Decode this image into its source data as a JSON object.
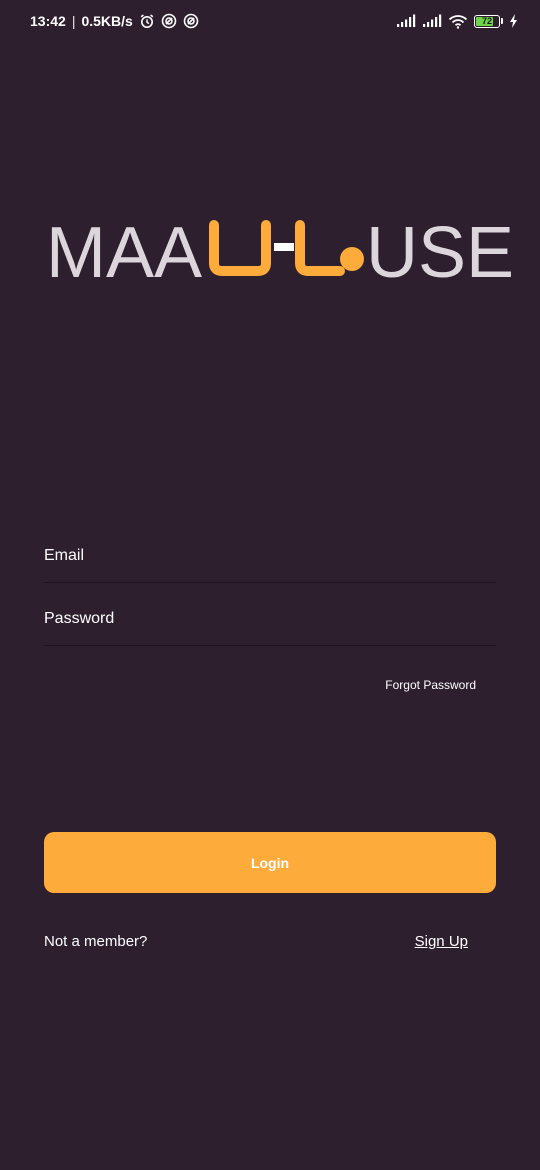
{
  "status_bar": {
    "time": "13:42",
    "separator": "|",
    "network_speed": "0.5KB/s",
    "battery_level": "72",
    "icons": [
      "alarm-icon",
      "sync-icon",
      "sync-icon",
      "signal-icon",
      "signal-icon",
      "wifi-icon",
      "battery-icon",
      "charging-icon"
    ],
    "battery_color": "#6fd34a"
  },
  "logo": {
    "text": "MAAUHOUSE",
    "left_text": "MAA",
    "right_text": "USE",
    "accent_color": "#fdab3a",
    "text_color": "#dcd6dc"
  },
  "form": {
    "email_placeholder": "Email",
    "password_placeholder": "Password",
    "forgot_label": "Forgot Password",
    "login_label": "Login",
    "login_color": "#fdab3a"
  },
  "footer": {
    "not_member_label": "Not a member?",
    "signup_label": "Sign Up"
  }
}
